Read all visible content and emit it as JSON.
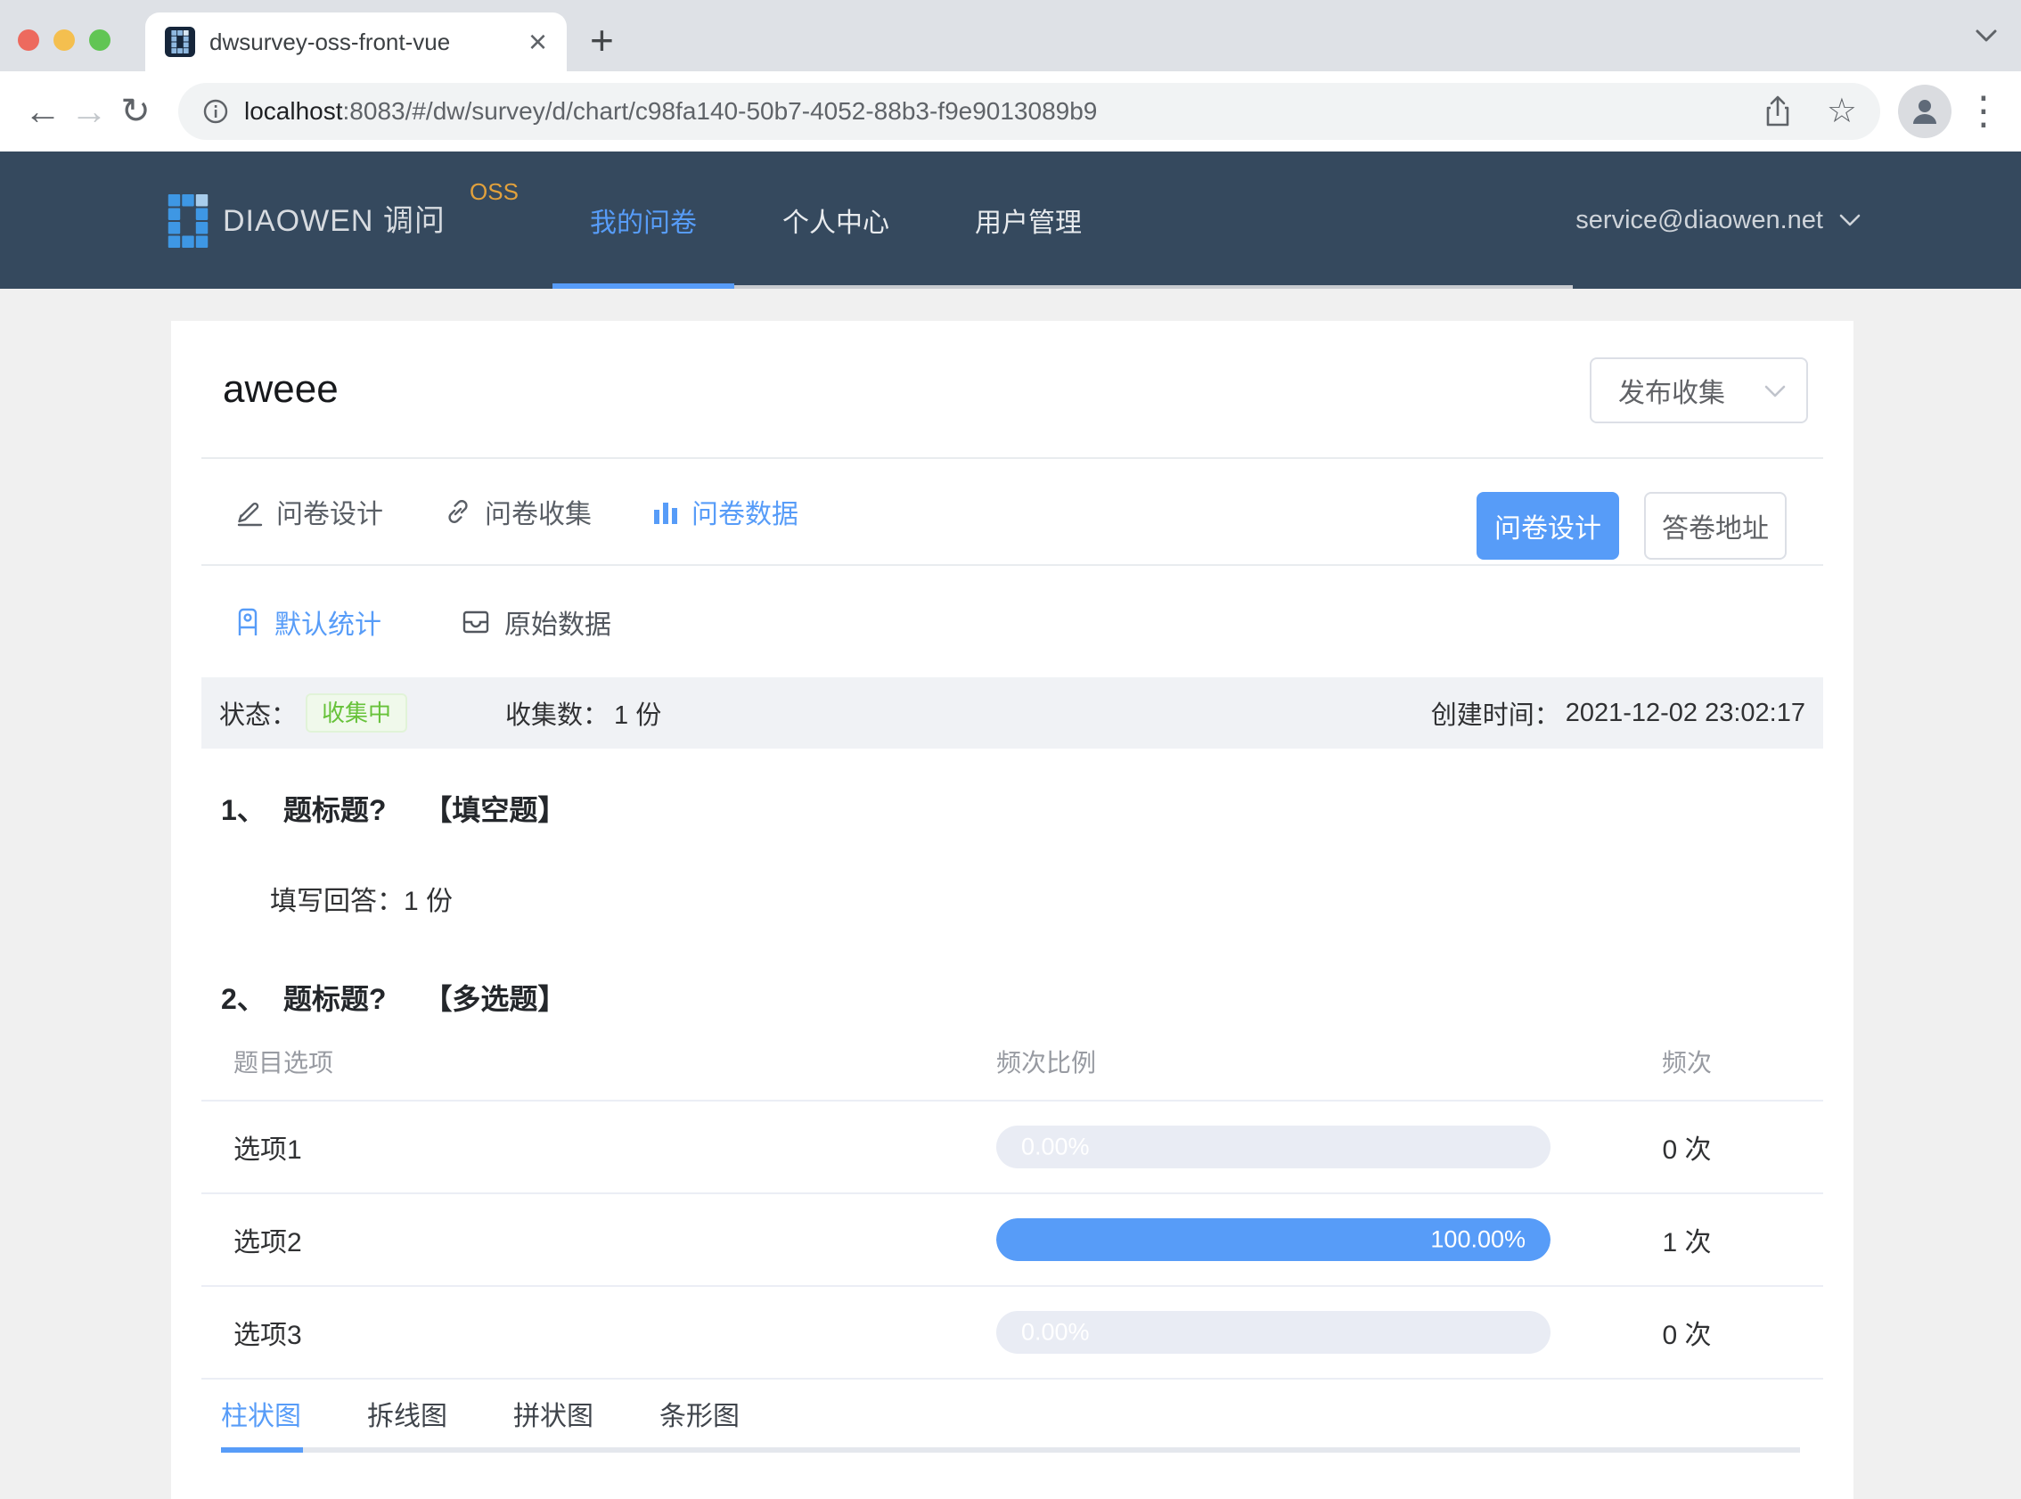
{
  "browser": {
    "tab": {
      "title": "dwsurvey-oss-front-vue"
    },
    "url": {
      "host": "localhost",
      "rest": ":8083/#/dw/survey/d/chart/c98fa140-50b7-4052-88b3-f9e9013089b9"
    },
    "glyphs": {
      "close": "×",
      "new_tab": "+",
      "back": "←",
      "forward": "→",
      "reload": "↻",
      "star": "☆",
      "menu": "⋮"
    }
  },
  "navbar": {
    "brand": "DIAOWEN 调问",
    "brand_sup": "OSS",
    "menu": [
      {
        "label": "我的问卷",
        "active": true
      },
      {
        "label": "个人中心",
        "active": false
      },
      {
        "label": "用户管理",
        "active": false
      }
    ],
    "account": "service@diaowen.net"
  },
  "card": {
    "title": "aweee",
    "publish_select": "发布收集",
    "nav_tabs": [
      {
        "label": "问卷设计",
        "icon": "edit-icon",
        "active": false
      },
      {
        "label": "问卷收集",
        "icon": "link-icon",
        "active": false
      },
      {
        "label": "问卷数据",
        "icon": "bar-chart-icon",
        "active": true
      }
    ],
    "primary_button": "问卷设计",
    "secondary_button": "答卷地址",
    "stat_tabs": [
      {
        "label": "默认统计",
        "icon": "tag-icon",
        "active": true
      },
      {
        "label": "原始数据",
        "icon": "inbox-icon",
        "active": false
      }
    ],
    "status": {
      "state_label": "状态：",
      "state_value": "收集中",
      "count_label": "收集数：",
      "count_value": "1 份",
      "created_label": "创建时间：",
      "created_value": "2021-12-02 23:02:17"
    },
    "question1": {
      "num": "1、",
      "title": "题标题?",
      "type": "【填空题】",
      "answer_label": "填写回答：",
      "answer_value": "1 份"
    },
    "question2": {
      "num": "2、",
      "title": "题标题?",
      "type": "【多选题】",
      "table": {
        "headers": [
          "题目选项",
          "频次比例",
          "频次"
        ],
        "rows": [
          {
            "option": "选项1",
            "percent_label": "0.00%",
            "percent": 0,
            "count": "0 次"
          },
          {
            "option": "选项2",
            "percent_label": "100.00%",
            "percent": 100,
            "count": "1 次"
          },
          {
            "option": "选项3",
            "percent_label": "0.00%",
            "percent": 0,
            "count": "0 次"
          }
        ]
      },
      "chart_tabs": [
        {
          "label": "柱状图",
          "active": true
        },
        {
          "label": "拆线图",
          "active": false
        },
        {
          "label": "拼状图",
          "active": false
        },
        {
          "label": "条形图",
          "active": false
        }
      ]
    },
    "colors": {
      "primary_blue": "#579cf8",
      "navbar_bg": "#35495e",
      "brand_orange": "#e2a13c",
      "success_green": "#67c23a",
      "success_bg": "#f0f9eb",
      "bar_track": "#e9ecf4"
    }
  }
}
